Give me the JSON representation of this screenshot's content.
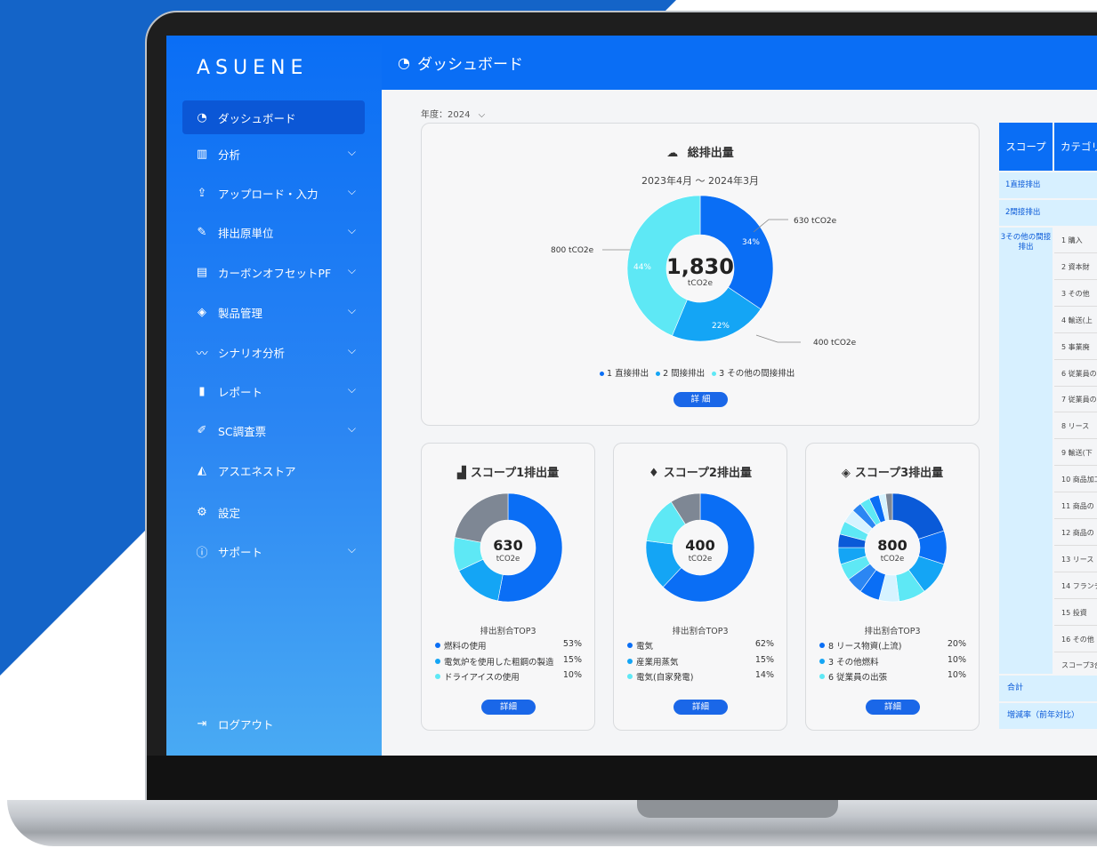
{
  "app": {
    "logo": "ASUENE",
    "page_title": "ダッシュボード"
  },
  "sidebar": {
    "items": [
      {
        "label": "ダッシュボード",
        "icon": "dashboard-icon",
        "active": true,
        "has_chevron": false
      },
      {
        "label": "分析",
        "icon": "bar-chart-icon",
        "active": false,
        "has_chevron": true
      },
      {
        "label": "アップロード・入力",
        "icon": "upload-icon",
        "active": false,
        "has_chevron": true
      },
      {
        "label": "排出原単位",
        "icon": "ruler-icon",
        "active": false,
        "has_chevron": true
      },
      {
        "label": "カーボンオフセットPF",
        "icon": "monitor-icon",
        "active": false,
        "has_chevron": true
      },
      {
        "label": "製品管理",
        "icon": "box-icon",
        "active": false,
        "has_chevron": true
      },
      {
        "label": "シナリオ分析",
        "icon": "trend-icon",
        "active": false,
        "has_chevron": true
      },
      {
        "label": "レポート",
        "icon": "document-icon",
        "active": false,
        "has_chevron": true
      },
      {
        "label": "SC調査票",
        "icon": "pen-icon",
        "active": false,
        "has_chevron": true
      },
      {
        "label": "アスエネストア",
        "icon": "store-icon",
        "active": false,
        "has_chevron": false
      },
      {
        "label": "設定",
        "icon": "gear-icon",
        "active": false,
        "has_chevron": false
      },
      {
        "label": "サポート",
        "icon": "info-icon",
        "active": false,
        "has_chevron": true
      }
    ],
    "logout": "ログアウト"
  },
  "filter": {
    "year_label": "年度：2024"
  },
  "total": {
    "title": "総排出量",
    "period": "2023年4月 〜 2024年3月",
    "value": "1,830",
    "unit": "tCO2e",
    "callouts": {
      "scope1": "630 tCO2e",
      "scope2": "400 tCO2e",
      "scope3": "800 tCO2e"
    },
    "slice_labels": {
      "scope1": "34%",
      "scope2": "22%",
      "scope3": "44%"
    },
    "legend": [
      "1 直接排出",
      "2 間接排出",
      "3 その他の間接排出"
    ],
    "detail_button": "詳 細"
  },
  "scope_cards": [
    {
      "title": "スコープ1排出量",
      "icon": "factory-icon",
      "value": "630",
      "unit": "tCO2e",
      "top3_title": "排出割合TOP3",
      "top3": [
        {
          "label": "燃料の使用",
          "pct": "53%"
        },
        {
          "label": "電気炉を使用した粗鋼の製造",
          "pct": "15%"
        },
        {
          "label": "ドライアイスの使用",
          "pct": "10%"
        }
      ],
      "button": "詳細"
    },
    {
      "title": "スコープ2排出量",
      "icon": "lightbulb-icon",
      "value": "400",
      "unit": "tCO2e",
      "top3_title": "排出割合TOP3",
      "top3": [
        {
          "label": "電気",
          "pct": "62%"
        },
        {
          "label": "産業用蒸気",
          "pct": "15%"
        },
        {
          "label": "電気(自家発電)",
          "pct": "14%"
        }
      ],
      "button": "詳細"
    },
    {
      "title": "スコープ3排出量",
      "icon": "box-icon",
      "value": "800",
      "unit": "tCO2e",
      "top3_title": "排出割合TOP3",
      "top3": [
        {
          "label": "8 リース物資(上流)",
          "pct": "20%"
        },
        {
          "label": "3 その他燃料",
          "pct": "10%"
        },
        {
          "label": "6 従業員の出張",
          "pct": "10%"
        }
      ],
      "button": "詳細"
    }
  ],
  "table": {
    "headers": [
      "スコープ",
      "カテゴリ"
    ],
    "scope1": "1直接排出",
    "scope2": "2間接排出",
    "scope3": "3その他の間接排出",
    "categories": [
      "1 購入",
      "2 資本財",
      "3 その他",
      "4 輸送(上",
      "5 事業廃",
      "6 従業員の",
      "7 従業員の",
      "8 リース",
      "9 輸送(下",
      "10 商品加工",
      "11 商品の",
      "12 商品の",
      "13 リース",
      "14 フランチ",
      "15 投資",
      "16 その他",
      "スコープ3合"
    ],
    "total_label": "合計",
    "growth_label": "増減率（前年対比）"
  },
  "colors": {
    "primary": "#0a6ef5",
    "scope1": "#0a6ef5",
    "scope2": "#14a5f5",
    "scope3": "#5ee8f5",
    "other": "#7e8794"
  },
  "chart_data": [
    {
      "type": "pie",
      "categories": [
        "1 直接排出",
        "2 間接排出",
        "3 その他の間接排出"
      ],
      "values": [
        630,
        400,
        800
      ],
      "percent": [
        34,
        22,
        44
      ]
    },
    {
      "type": "pie",
      "categories": [
        "燃料の使用",
        "電気炉を使用した粗鋼の製造",
        "ドライアイスの使用"
      ],
      "values": [
        53,
        15,
        10
      ]
    },
    {
      "type": "pie",
      "categories": [
        "電気",
        "産業用蒸気",
        "電気(自家発電)"
      ],
      "values": [
        62,
        15,
        14
      ]
    },
    {
      "type": "pie",
      "categories": [
        "8 リース物資(上流)",
        "3 その他燃料",
        "6 従業員の出張"
      ],
      "values": [
        20,
        10,
        10
      ]
    }
  ]
}
